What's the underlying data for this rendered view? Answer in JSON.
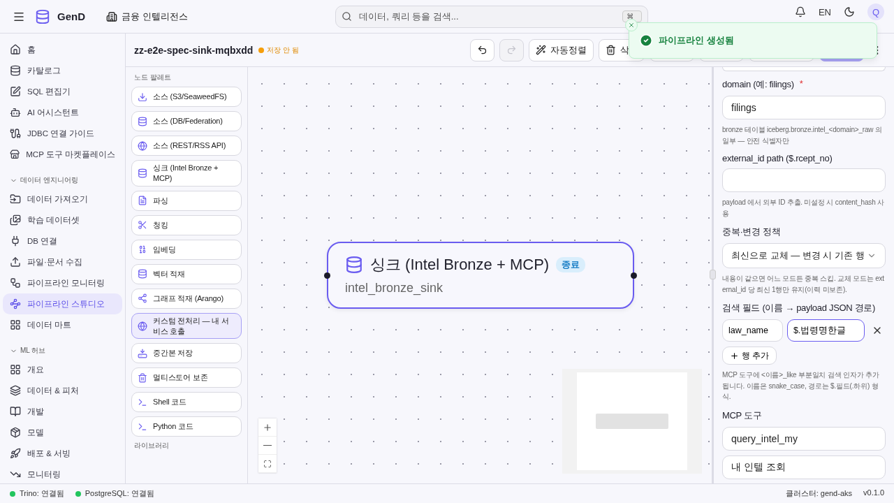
{
  "topbar": {
    "app_name": "GenD",
    "workspace": "금융 인텔리전스",
    "search": {
      "placeholder": "데이터, 쿼리 등을 검색...",
      "shortcut": "⌘"
    },
    "language": "EN",
    "avatar": "Q"
  },
  "toast": {
    "message": "파이프라인 생성됨"
  },
  "sidebar": {
    "items": [
      {
        "label": "홈",
        "selected": false
      },
      {
        "label": "카탈로그",
        "selected": false
      },
      {
        "label": "SQL 편집기",
        "selected": false
      },
      {
        "label": "AI 어시스턴트",
        "selected": false
      },
      {
        "label": "JDBC 연결 가이드",
        "selected": false
      },
      {
        "label": "MCP 도구 마켓플레이스",
        "selected": false
      }
    ],
    "sections": [
      {
        "title": "데이터 엔지니어링",
        "expanded": true,
        "items": [
          {
            "label": "데이터 가져오기",
            "selected": false
          },
          {
            "label": "학습 데이터셋",
            "selected": false
          },
          {
            "label": "DB 연결",
            "selected": false
          },
          {
            "label": "파일·문서 수집",
            "selected": false
          },
          {
            "label": "파이프라인 모니터링",
            "selected": false
          },
          {
            "label": "파이프라인 스튜디오",
            "selected": true
          },
          {
            "label": "데이터 마트",
            "selected": false
          }
        ]
      },
      {
        "title": "ML 허브",
        "expanded": true,
        "items": [
          {
            "label": "개요",
            "selected": false
          },
          {
            "label": "데이터 & 피처",
            "selected": false
          },
          {
            "label": "개발",
            "selected": false
          },
          {
            "label": "모델",
            "selected": false
          },
          {
            "label": "배포 & 서빙",
            "selected": false
          },
          {
            "label": "모니터링",
            "selected": false
          }
        ]
      }
    ]
  },
  "header": {
    "pipeline_name": "zz-e2e-spec-sink-mqbxdd",
    "status": "저장 안 됨",
    "toolbar": [
      {
        "kind": "icon",
        "disabled": false
      },
      {
        "kind": "icon",
        "disabled": true
      },
      {
        "kind": "text",
        "label": "자동정렬",
        "disabled": false
      },
      {
        "kind": "text",
        "label": "삭",
        "disabled": false
      },
      {
        "kind": "blank"
      },
      {
        "kind": "blank"
      },
      {
        "kind": "blank"
      },
      {
        "kind": "primary"
      },
      {
        "kind": "more"
      }
    ]
  },
  "palette": {
    "title": "노드 팔레트",
    "items": [
      {
        "label": "소스 (S3/SeaweedFS)",
        "selected": false
      },
      {
        "label": "소스 (DB/Federation)",
        "selected": false
      },
      {
        "label": "소스 (REST/RSS API)",
        "selected": false
      },
      {
        "label": "싱크 (Intel Bronze + MCP)",
        "selected": false
      },
      {
        "label": "파싱",
        "selected": false
      },
      {
        "label": "청킹",
        "selected": false
      },
      {
        "label": "임베딩",
        "selected": false
      },
      {
        "label": "벡터 적재",
        "selected": false
      },
      {
        "label": "그래프 적재 (Arango)",
        "selected": false
      },
      {
        "label": "커스텀 전처리 — 내 서비스 호출",
        "selected": true
      },
      {
        "label": "중간본 저장",
        "selected": false
      },
      {
        "label": "멀티스토어 보존",
        "selected": false
      },
      {
        "label": "Shell 코드",
        "selected": false
      },
      {
        "label": "Python 코드",
        "selected": false
      }
    ],
    "library_title": "라이브러리"
  },
  "canvas": {
    "node": {
      "title": "싱크 (Intel Bronze + MCP)",
      "badge": "종료",
      "name": "intel_bronze_sink",
      "selected": true
    }
  },
  "properties": {
    "fields": [
      {
        "kind": "input",
        "label": "domain (예: filings)",
        "required_mark": "*",
        "value": "filings",
        "hint": "bronze 테이블 iceberg.bronze.intel_<domain>_raw 의 일부 — 안전 식별자만"
      },
      {
        "kind": "input",
        "label": "external_id path ($.rcept_no)",
        "hint": "payload 에서 외부 ID 추출. 미설정 시 content_hash 사용"
      },
      {
        "kind": "select",
        "label": "중복·변경 정책",
        "value": "최신으로 교체 — 변경 시 기존 행",
        "hint": "내용이 같으면 어느 모드든 중복 스킵. 교체 모드는 external_id 당 최신 1행만 유지(이력 미보존)."
      },
      {
        "kind": "pairs",
        "label": "검색 필드 (이름 → payload JSON 경로)",
        "rows": [
          {
            "name": "law_name",
            "path": "$.법령명한글",
            "focused": true
          }
        ],
        "add_label": "행 추가",
        "hint": "MCP 도구에 <이름>_like 부분일치 검색 인자가 추가됩니다. 이름은 snake_case, 경로는 $.필드(.하위) 형식."
      },
      {
        "kind": "input",
        "label": "MCP 도구",
        "value": "query_intel_my"
      },
      {
        "kind": "input",
        "value": "내 인텔 조회"
      }
    ]
  },
  "status_bar": {
    "connections": [
      {
        "label": "Trino: 연결됨",
        "color": "#22c55e"
      },
      {
        "label": "PostgreSQL: 연결됨",
        "color": "#22c55e"
      }
    ],
    "cluster": "클러스터: gend-aks",
    "version": "v0.1.0"
  }
}
